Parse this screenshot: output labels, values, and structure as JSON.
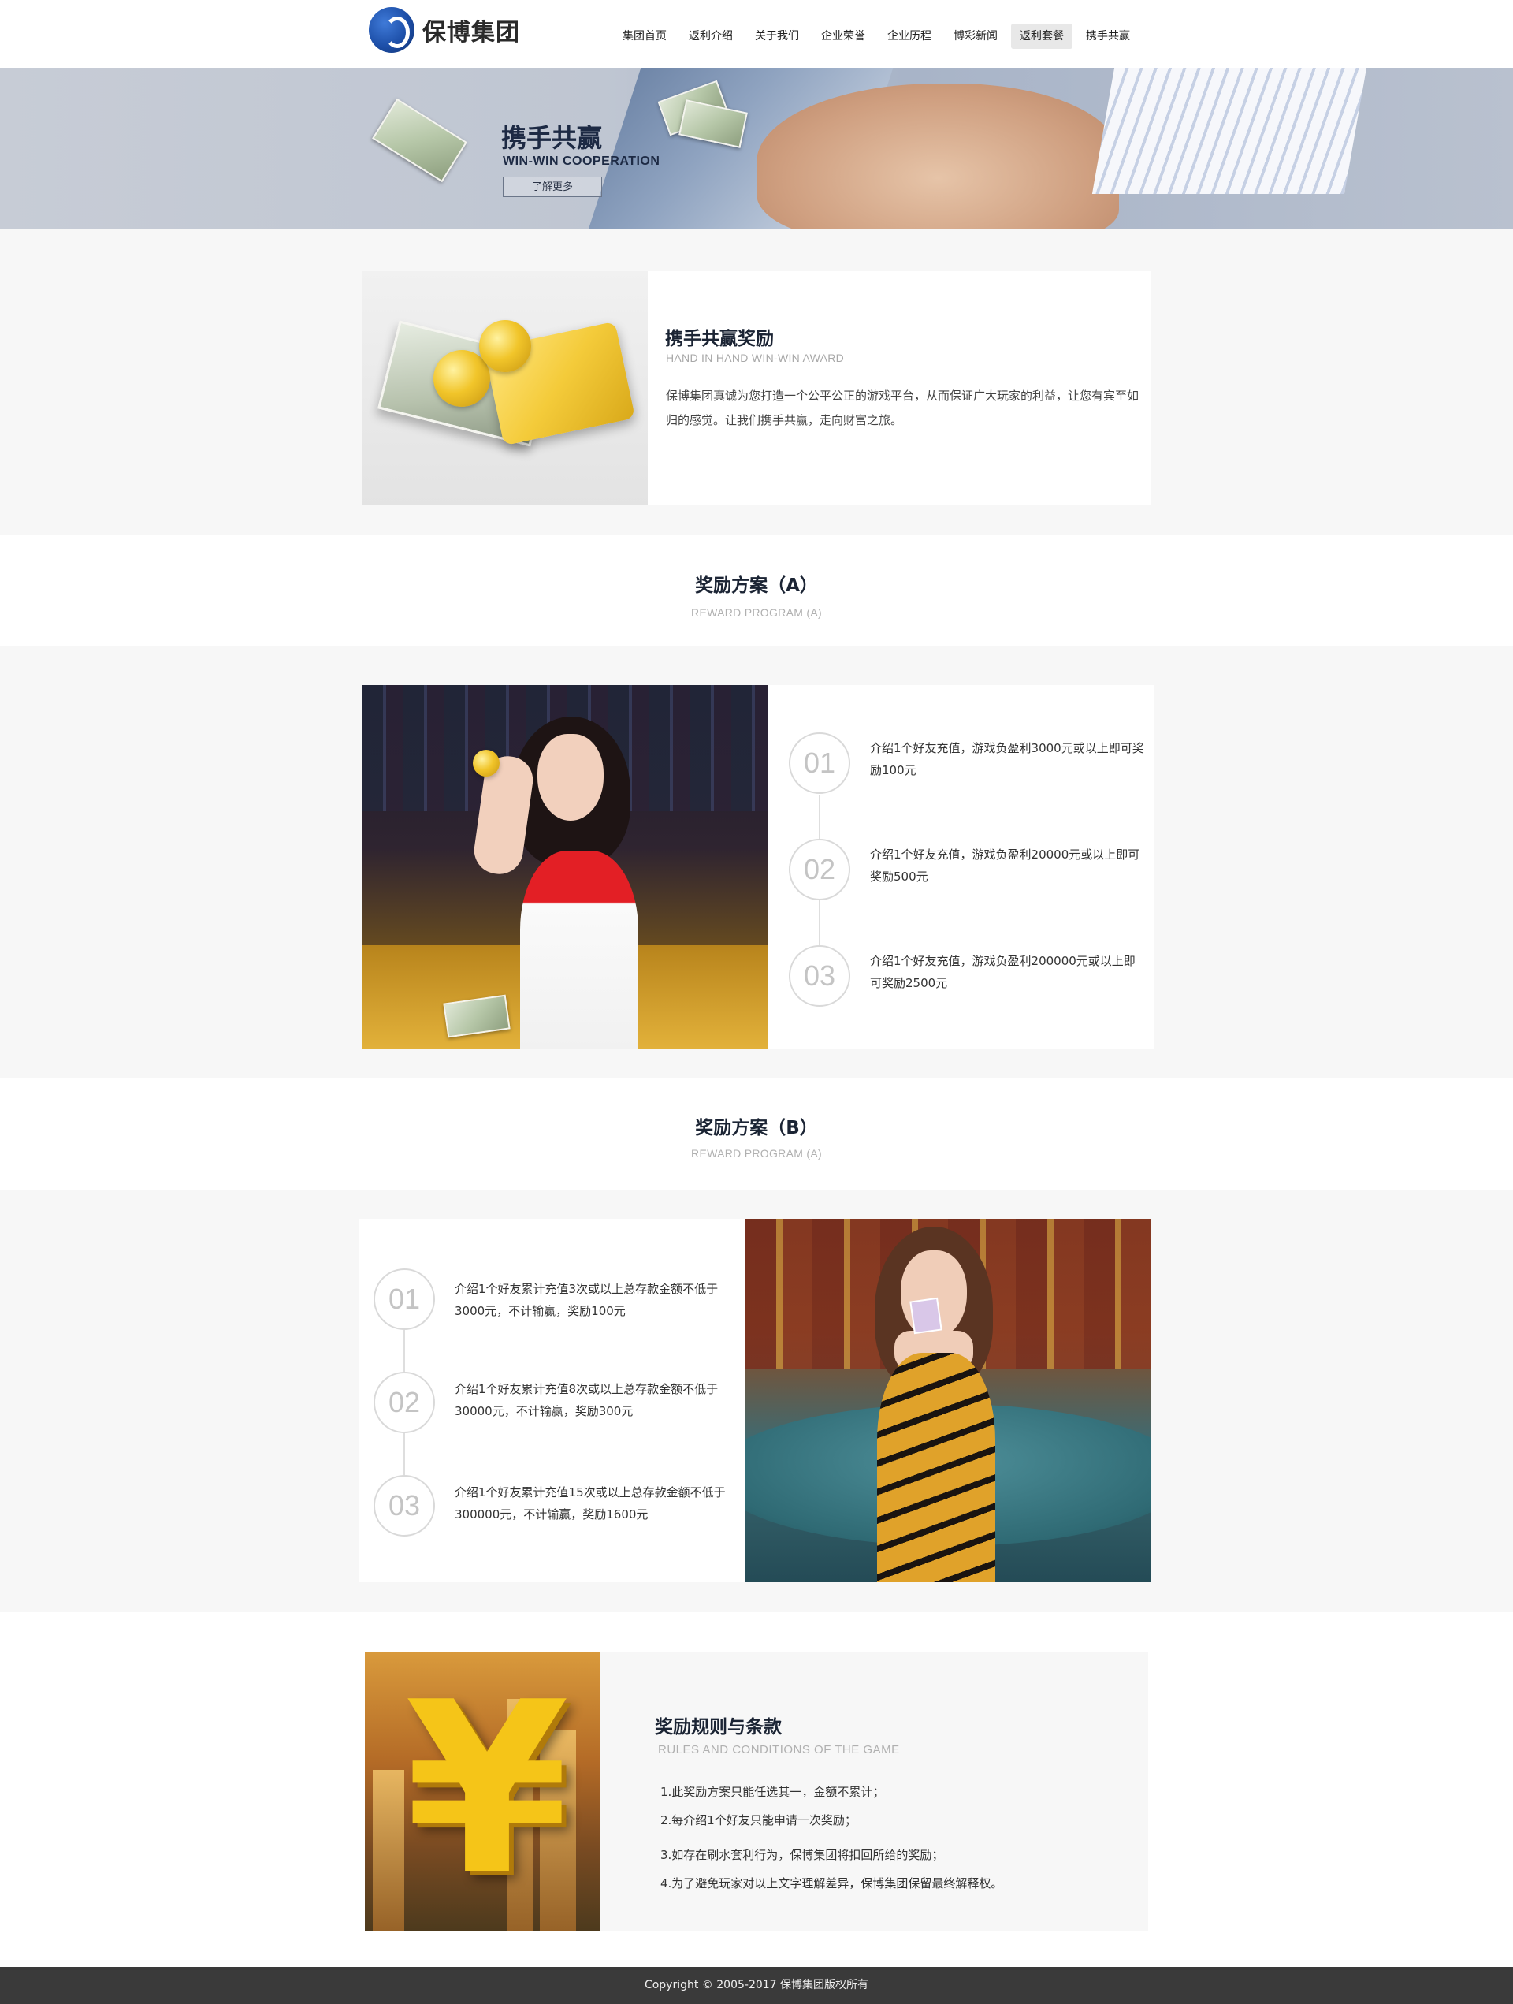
{
  "header": {
    "logo_text": "保博集团",
    "nav": [
      {
        "label": "集团首页",
        "active": false
      },
      {
        "label": "返利介绍",
        "active": false
      },
      {
        "label": "关于我们",
        "active": false
      },
      {
        "label": "企业荣誉",
        "active": false
      },
      {
        "label": "企业历程",
        "active": false
      },
      {
        "label": "博彩新闻",
        "active": false
      },
      {
        "label": "返利套餐",
        "active": true
      },
      {
        "label": "携手共赢",
        "active": false
      }
    ]
  },
  "banner": {
    "title": "携手共赢",
    "subtitle": "WIN-WIN COOPERATION",
    "button": "了解更多"
  },
  "intro": {
    "title": "携手共赢奖励",
    "subtitle": "HAND IN HAND WIN-WIN AWARD",
    "text": "保博集团真诚为您打造一个公平公正的游戏平台，从而保证广大玩家的利益，让您有宾至如归的感觉。让我们携手共赢，走向财富之旅。"
  },
  "program_a": {
    "title": "奖励方案（A）",
    "subtitle": "REWARD PROGRAM (A)",
    "steps": [
      {
        "num": "01",
        "text": "介绍1个好友充值，游戏负盈利3000元或以上即可奖励100元"
      },
      {
        "num": "02",
        "text": "介绍1个好友充值，游戏负盈利20000元或以上即可奖励500元"
      },
      {
        "num": "03",
        "text": "介绍1个好友充值，游戏负盈利200000元或以上即可奖励2500元"
      }
    ]
  },
  "program_b": {
    "title": "奖励方案（B）",
    "subtitle": "REWARD PROGRAM (A)",
    "steps": [
      {
        "num": "01",
        "text": "介绍1个好友累计充值3次或以上总存款金额不低于3000元，不计输赢，奖励100元"
      },
      {
        "num": "02",
        "text": "介绍1个好友累计充值8次或以上总存款金额不低于30000元，不计输赢，奖励300元"
      },
      {
        "num": "03",
        "text": "介绍1个好友累计充值15次或以上总存款金额不低于300000元，不计输赢，奖励1600元"
      }
    ]
  },
  "rules": {
    "title": "奖励规则与条款",
    "subtitle": "RULES AND CONDITIONS OF THE GAME",
    "items": [
      "1.此奖励方案只能任选其一，金额不累计；",
      "2.每介绍1个好友只能申请一次奖励；",
      "3.如存在刷水套利行为，保博集团将扣回所给的奖励；",
      "4.为了避免玩家对以上文字理解差异，保博集团保留最终解释权。"
    ]
  },
  "footer": {
    "copyright": "Copyright © 2005-2017 保博集团版权所有"
  }
}
